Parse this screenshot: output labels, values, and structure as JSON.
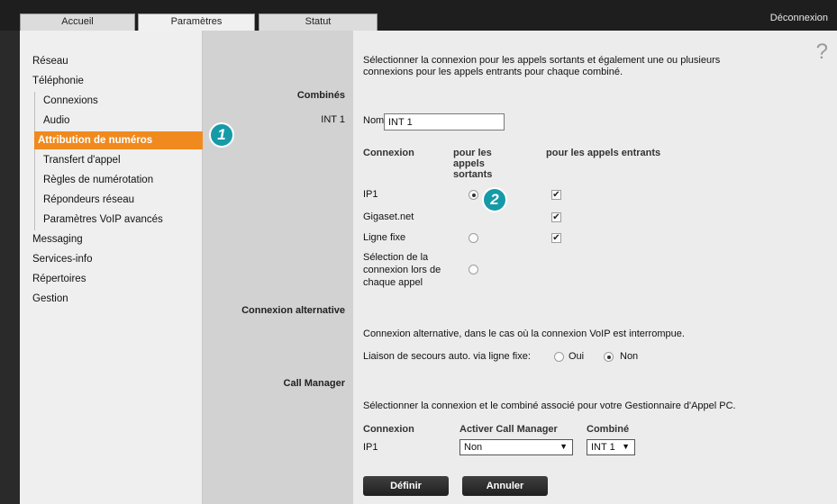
{
  "tabs": [
    "Accueil",
    "Paramètres",
    "Statut"
  ],
  "logout": "Déconnexion",
  "help_glyph": "?",
  "sidebar": {
    "items": [
      "Réseau",
      "Téléphonie",
      "Connexions",
      "Audio",
      "Attribution de numéros",
      "Transfert d'appel",
      "Règles de numérotation",
      "Répondeurs réseau",
      "Paramètres VoIP avancés",
      "Messaging",
      "Services-info",
      "Répertoires",
      "Gestion"
    ]
  },
  "markers": [
    "1",
    "2"
  ],
  "intro": {
    "line1": "Sélectionner la connexion pour les appels sortants et également une ou plusieurs",
    "line2": "connexions pour les appels entrants pour chaque combiné."
  },
  "combines": {
    "heading": "Combinés",
    "handset_label": "INT 1",
    "name_label": "Nom",
    "name_value": "INT 1",
    "col_connexion": "Connexion",
    "col_out": [
      "pour les",
      "appels",
      "sortants"
    ],
    "col_in": "pour les appels entrants",
    "rows": [
      {
        "label": "IP1",
        "outgoing": "selected",
        "incoming": "checked"
      },
      {
        "label": "Gigaset.net",
        "outgoing": "none",
        "incoming": "checked"
      },
      {
        "label": "Ligne fixe",
        "outgoing": "unselected",
        "incoming": "checked"
      }
    ],
    "select_each_call": [
      "Sélection de la",
      "connexion lors de",
      "chaque appel"
    ],
    "check_glyph": "✔"
  },
  "alternative": {
    "heading": "Connexion alternative",
    "description": "Connexion alternative, dans le cas où la connexion VoIP est interrompue.",
    "fallback_label": "Liaison de secours auto. via ligne fixe:",
    "opt_yes": "Oui",
    "opt_no": "Non",
    "selected": "Non"
  },
  "call_manager": {
    "heading": "Call Manager",
    "description": "Sélectionner la connexion et le combiné associé pour votre Gestionnaire d'Appel PC.",
    "col_connexion": "Connexion",
    "col_activate": "Activer Call Manager",
    "col_handset": "Combiné",
    "row_connexion": "IP1",
    "activate_value": "Non",
    "handset_value": "INT 1",
    "arrow": "▼"
  },
  "buttons": {
    "define": "Définir",
    "cancel": "Annuler"
  }
}
